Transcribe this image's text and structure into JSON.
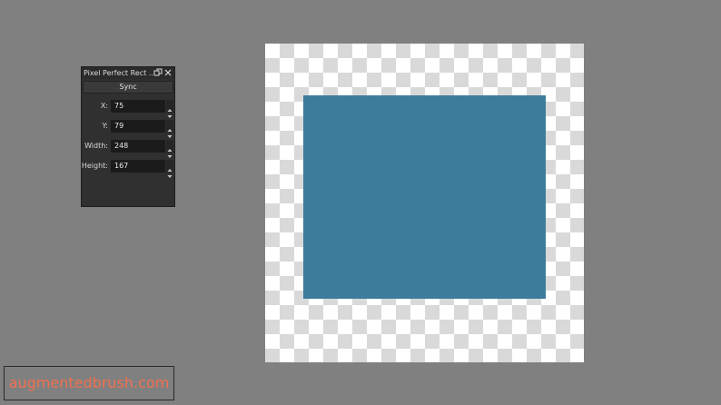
{
  "docker": {
    "title": "Pixel Perfect Rect ...",
    "sync_label": "Sync",
    "fields": [
      {
        "label": "X:",
        "value": "75"
      },
      {
        "label": "Y:",
        "value": "79"
      },
      {
        "label": "Width:",
        "value": "248"
      },
      {
        "label": "Height:",
        "value": "167"
      }
    ],
    "icons": {
      "float": "float-icon",
      "close": "close-icon",
      "spinner_up": "chevron-up-icon",
      "spinner_down": "chevron-down-icon"
    }
  },
  "canvas": {
    "shape_color": "#3e7c9b",
    "checker_light": "#ffffff",
    "checker_dark": "#d9d9d9"
  },
  "watermark": {
    "text": "augmentedbrush.com",
    "color": "#f07050"
  },
  "colors": {
    "workspace_bg": "#808080",
    "panel_bg": "#303030"
  }
}
